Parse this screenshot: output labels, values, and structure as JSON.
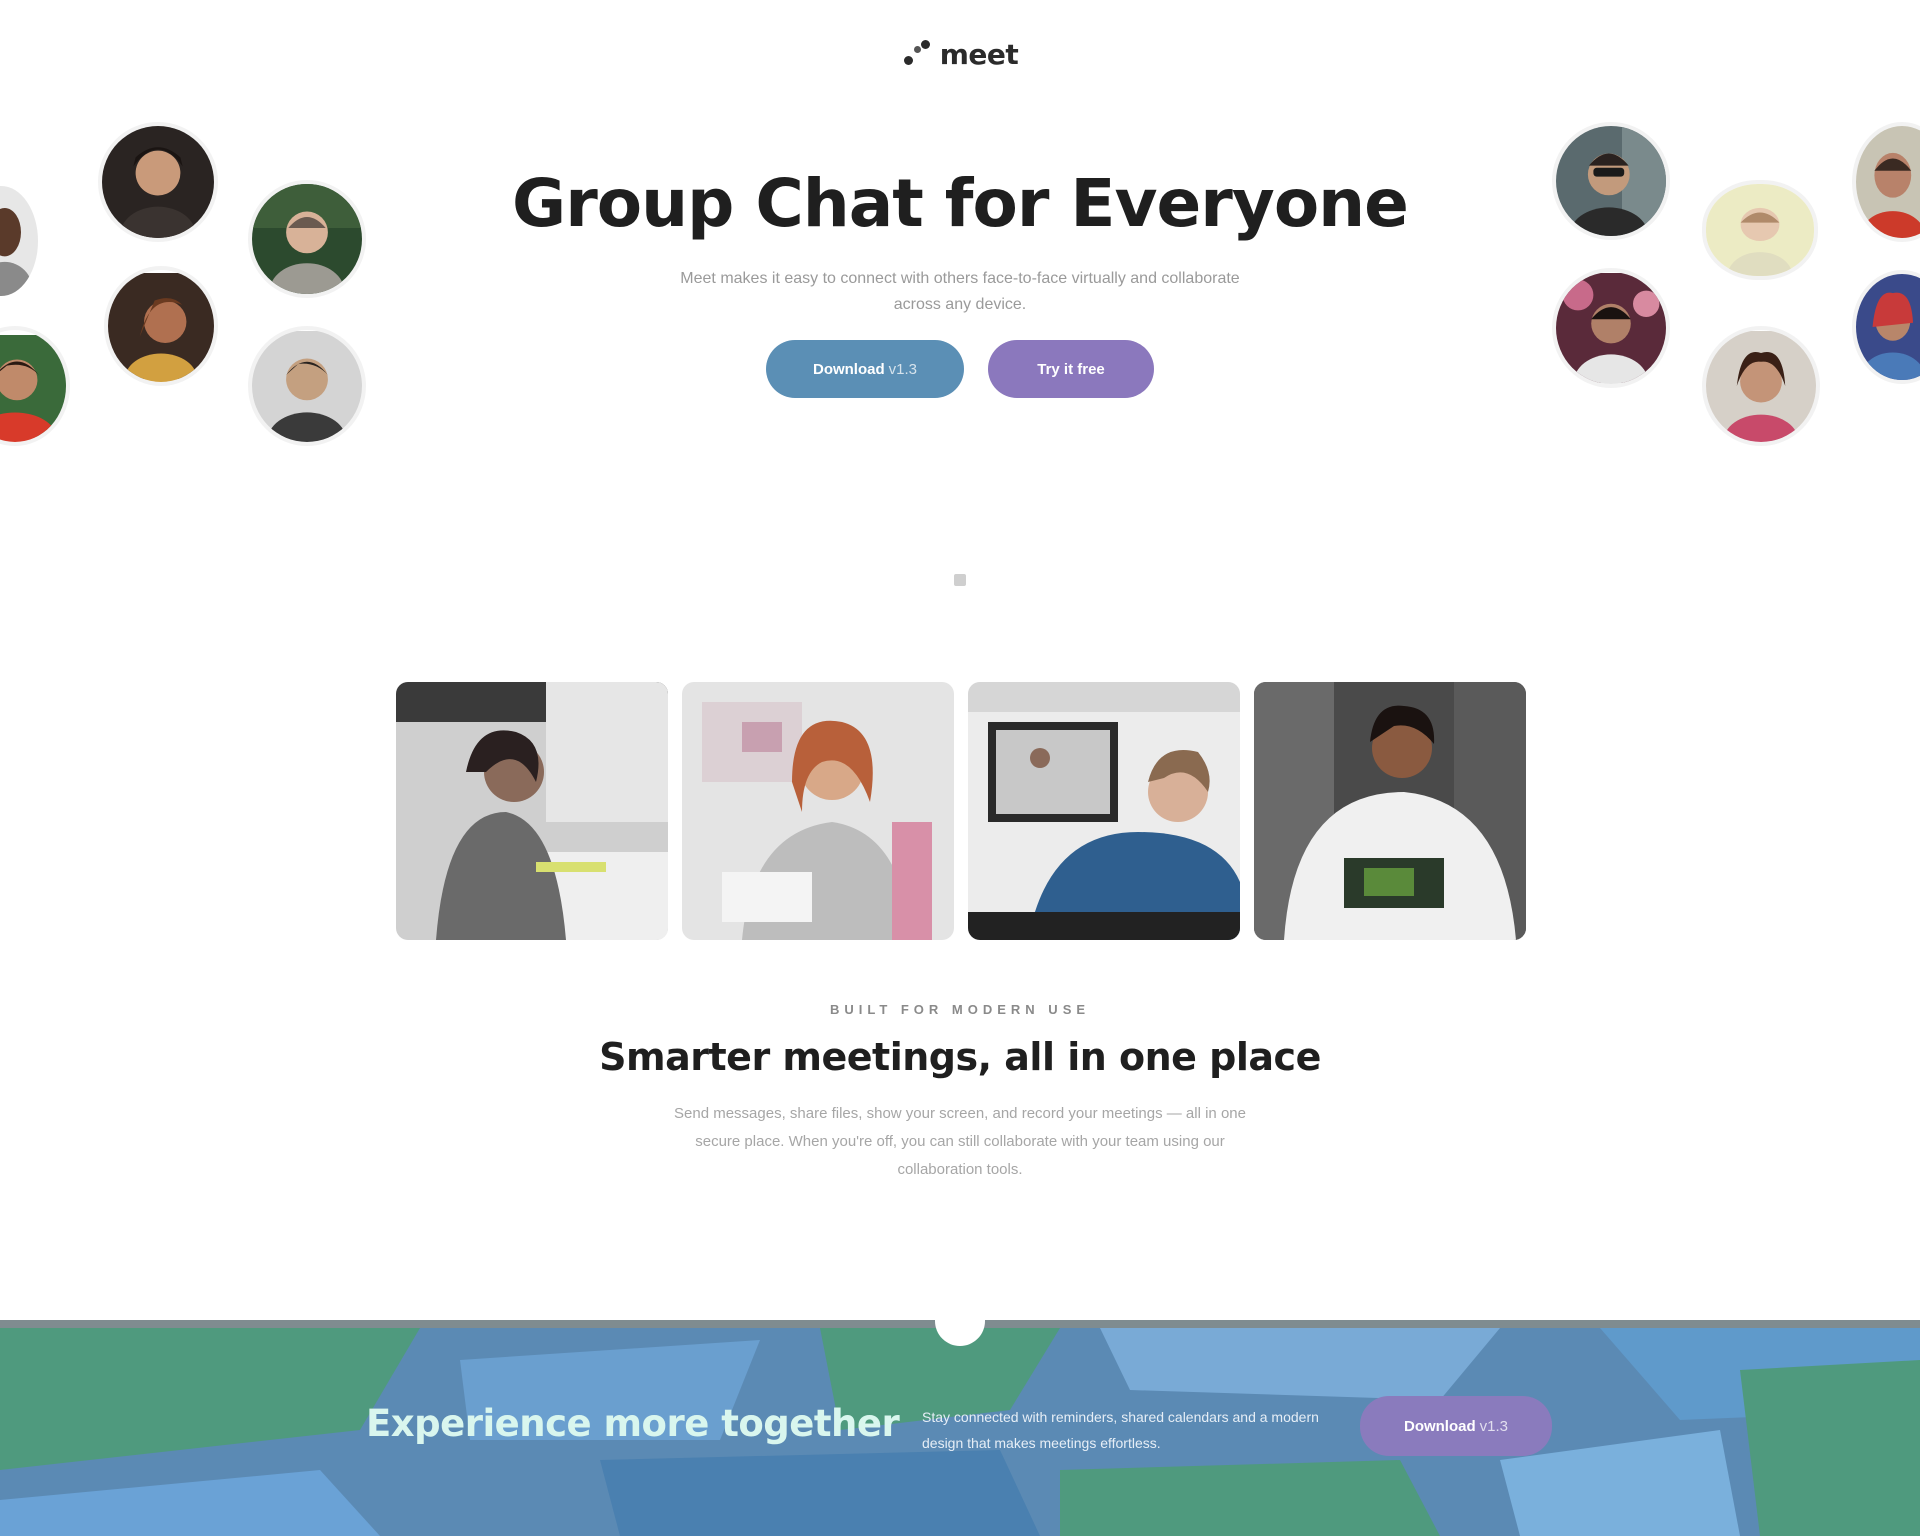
{
  "header": {
    "logo_text": "meet"
  },
  "hero": {
    "title": "Group Chat for Everyone",
    "subtitle": "Meet makes it easy to connect with others face-to-face virtually and collaborate across any device.",
    "download_label": "Download",
    "download_suffix": "v1.3",
    "try_label": "Try it free"
  },
  "photos": [
    {
      "subject": "woman-video-call-photo"
    },
    {
      "subject": "woman-laptop-photo"
    },
    {
      "subject": "man-video-conference-photo"
    },
    {
      "subject": "man-tablet-photo"
    }
  ],
  "feature": {
    "eyebrow": "BUILT FOR MODERN USE",
    "title": "Smarter meetings, all in one place",
    "text": "Send messages, share files, show your screen, and record your meetings — all in one secure place. When you're off, you can still collaborate with your team using our collaboration tools."
  },
  "cta_band": {
    "title": "Experience more together",
    "text": "Stay connected with reminders, shared calendars and a modern design that makes meetings effortless.",
    "download_label": "Download",
    "download_suffix": "v1.3"
  },
  "colors": {
    "primary_blue": "#5b8fb5",
    "accent_purple": "#8b78bd",
    "band_green": "#4f9a7e"
  }
}
